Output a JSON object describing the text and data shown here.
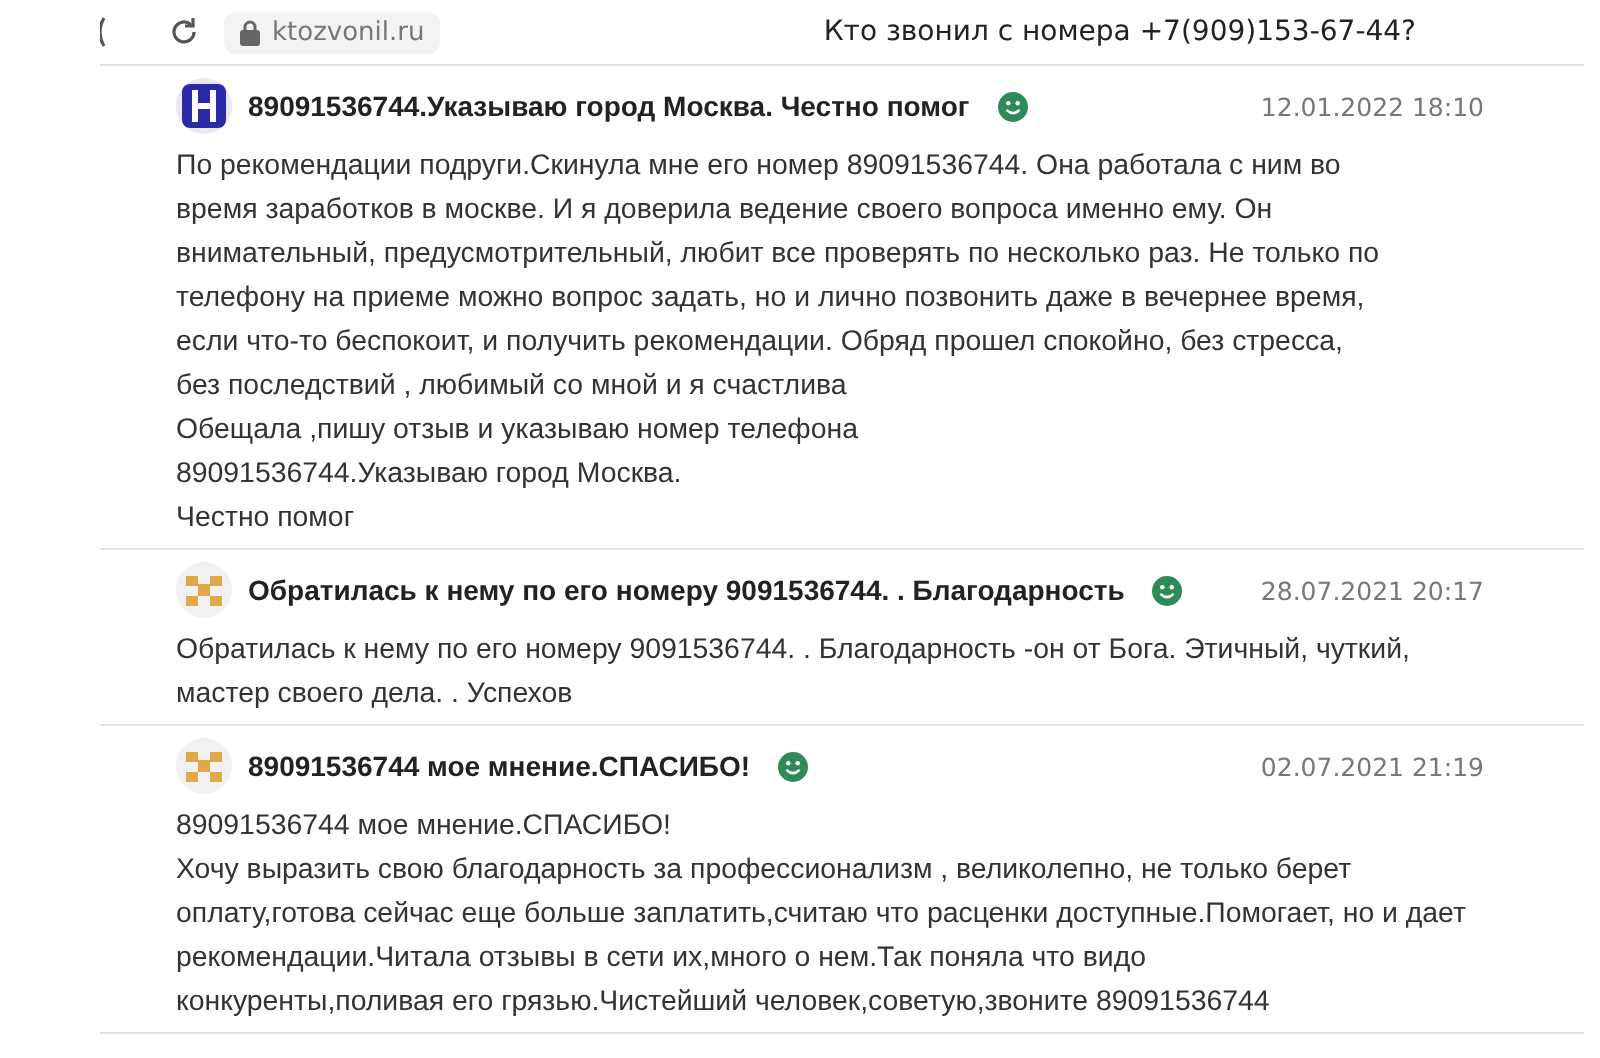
{
  "browser": {
    "url": "ktozvonil.ru",
    "page_title": "Кто звонил с номера +7(909)153-67-44?"
  },
  "comments": [
    {
      "kind": "letter",
      "title": "89091536744.Указываю город Москва. Честно помог",
      "date": "12.01.2022 18:10",
      "lines": [
        "По рекомендации подруги.Скинула мне его номер 89091536744. Она работала с ним во",
        "время заработков в москве. И я доверила ведение своего вопроса именно ему. Он",
        "внимательный, предусмотрительный, любит все проверять по несколько раз. Не только по",
        "телефону на приеме можно вопрос задать, но и лично позвонить даже в вечернее время,",
        "если что-то беспокоит, и получить рекомендации. Обряд прошел спокойно, без стресса,",
        "без последствий , любимый со мной и я счастлива",
        "Обещала ,пишу отзыв и указываю номер телефона",
        "89091536744.Указываю город Москва.",
        "Честно помог"
      ]
    },
    {
      "kind": "tiles",
      "title": "Обратилась к нему по его номеру 9091536744. . Благодарность",
      "date": "28.07.2021 20:17",
      "lines": [
        "Обратилась к нему по его номеру 9091536744. . Благодарность -он от Бога. Этичный, чуткий,",
        "мастер своего дела. . Успехов"
      ]
    },
    {
      "kind": "tiles",
      "title": "89091536744 мое мнение.СПАСИБО!",
      "date": "02.07.2021 21:19",
      "lines": [
        "89091536744 мое мнение.СПАСИБО!",
        "Хочу выразить свою благодарность за профессионализм , великолепно, не только берет",
        "оплату,готова сейчас еще больше заплатить,считаю что расценки доступные.Помогает, но и дает",
        "рекомендации.Читала отзывы в сети их,много о нем.Так поняла что видо",
        "конкуренты,поливая его грязью.Чистейший человек,советую,звоните 89091536744"
      ]
    }
  ]
}
